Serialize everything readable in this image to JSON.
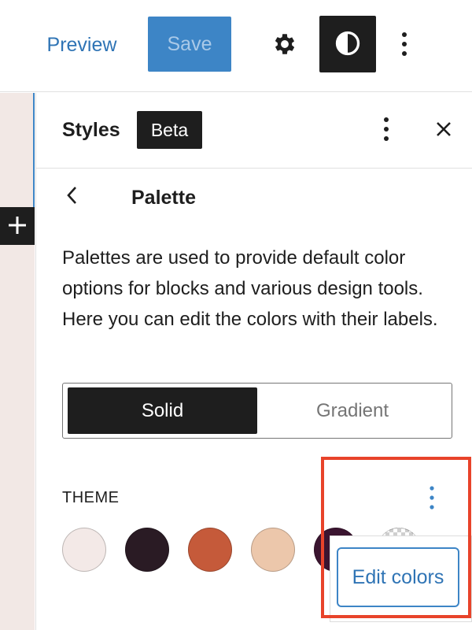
{
  "toolbar": {
    "preview_label": "Preview",
    "save_label": "Save",
    "settings_icon": "gear-icon",
    "styles_icon": "half-contrast-icon",
    "more_icon": "vertical-ellipsis-icon"
  },
  "canvas": {
    "inserter_icon": "plus-icon",
    "background_color": "#f2e8e5"
  },
  "panel": {
    "title": "Styles",
    "badge": "Beta",
    "more_icon": "vertical-ellipsis-icon",
    "close_icon": "close-icon"
  },
  "palette": {
    "back_icon": "chevron-left-icon",
    "title": "Palette",
    "description": "Palettes are used to provide default color options for blocks and various design tools. Here you can edit the colors with their labels.",
    "tabs": [
      {
        "label": "Solid",
        "selected": true
      },
      {
        "label": "Gradient",
        "selected": false
      }
    ],
    "theme_label": "THEME",
    "theme_more_icon": "vertical-ellipsis-icon",
    "swatches": [
      {
        "color": "#f3e9e7"
      },
      {
        "color": "#2a1b24"
      },
      {
        "color": "#c55a3a"
      },
      {
        "color": "#ecc7ab"
      },
      {
        "color": "#3b1530"
      },
      {
        "color": "transparent"
      }
    ]
  },
  "dropdown": {
    "edit_colors_label": "Edit colors"
  },
  "colors": {
    "accent": "#3d85c6",
    "dark": "#1e1e1e",
    "highlight": "#e8432a"
  }
}
